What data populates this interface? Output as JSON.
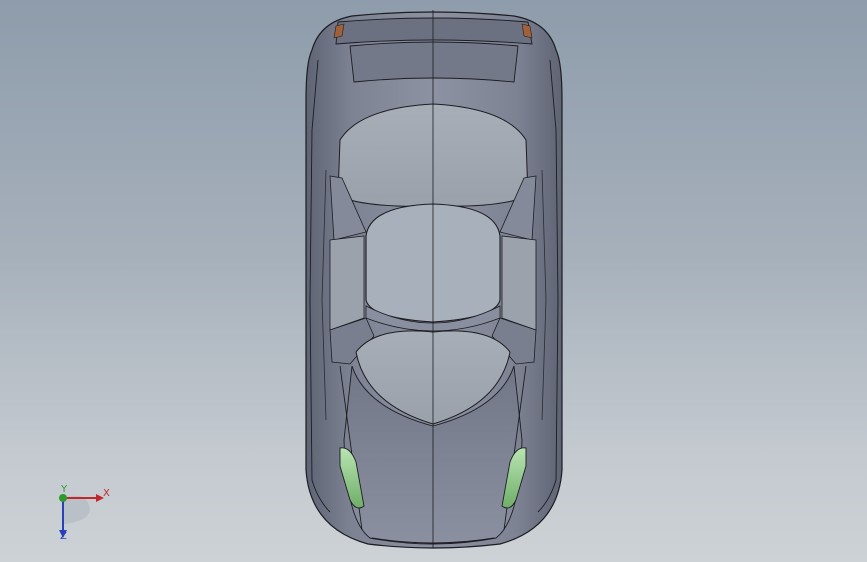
{
  "viewport": {
    "background_top": "#8e9cab",
    "background_bottom": "#cdd2d6"
  },
  "model": {
    "body_color": "#7c8192",
    "glass_color": "#aab1b9",
    "edge_color": "#1c1c22",
    "light_color": "#8fcf8a",
    "mirror_accent": "#a0603a"
  },
  "triad": {
    "x_label": "X",
    "y_label": "Y",
    "z_label": "Z",
    "x_color": "#c0282c",
    "y_color": "#2c9b2c",
    "z_color": "#2a3fb8"
  }
}
